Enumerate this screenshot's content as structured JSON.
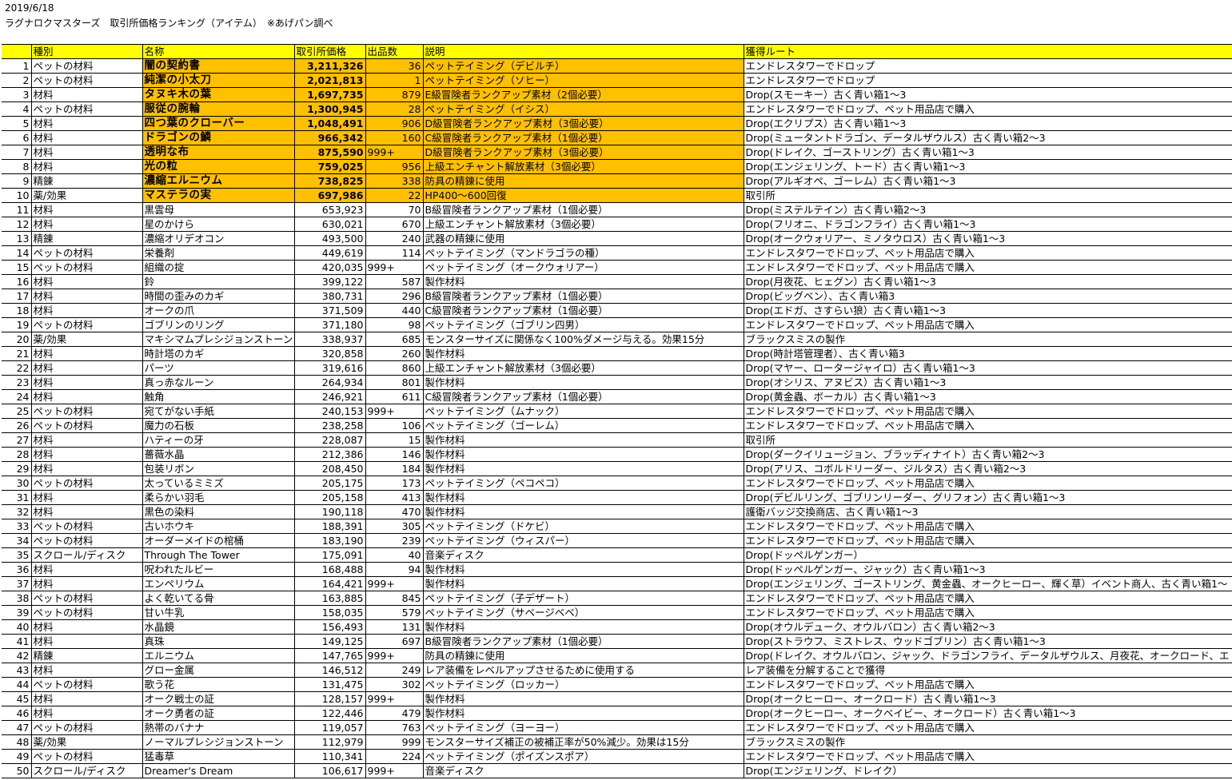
{
  "header": {
    "date": "2019/6/18",
    "title": "ラグナロクマスターズ　取引所価格ランキング（アイテム）　※あげパン調べ"
  },
  "columns": [
    "",
    "種別",
    "名称",
    "取引所価格",
    "出品数",
    "説明",
    "獲得ルート"
  ],
  "rows": [
    {
      "rank": "1",
      "type": "ペットの材料",
      "name": "闇の契約書",
      "price": "3,211,326",
      "count": "36",
      "desc": "ペットテイミング（デビルチ）",
      "route": "エンドレスタワーでドロップ"
    },
    {
      "rank": "2",
      "type": "ペットの材料",
      "name": "純潔の小太刀",
      "price": "2,021,813",
      "count": "1",
      "desc": "ペットテイミング（ソヒー）",
      "route": "エンドレスタワーでドロップ"
    },
    {
      "rank": "3",
      "type": "材料",
      "name": "タヌキ木の葉",
      "price": "1,697,735",
      "count": "879",
      "desc": "E級冒険者ランクアップ素材（2個必要）",
      "route": "Drop(スモーキー）古く青い箱1～3"
    },
    {
      "rank": "4",
      "type": "ペットの材料",
      "name": "服従の腕輪",
      "price": "1,300,945",
      "count": "28",
      "desc": "ペットテイミング（イシス）",
      "route": "エンドレスタワーでドロップ、ペット用品店で購入"
    },
    {
      "rank": "5",
      "type": "材料",
      "name": "四つ葉のクローバー",
      "price": "1,048,491",
      "count": "906",
      "desc": "D級冒険者ランクアップ素材（3個必要）",
      "route": "Drop(エクリプス）古く青い箱1～3"
    },
    {
      "rank": "6",
      "type": "材料",
      "name": "ドラゴンの鱗",
      "price": "966,342",
      "count": "160",
      "desc": "C級冒険者ランクアップ素材（1個必要）",
      "route": "Drop(ミュータントドラゴン、データルザウルス）古く青い箱2～3"
    },
    {
      "rank": "7",
      "type": "材料",
      "name": "透明な布",
      "price": "875,590",
      "count": "999+",
      "desc": "D級冒険者ランクアップ素材（3個必要）",
      "route": "Drop(ドレイク、ゴーストリング）古く青い箱1～3"
    },
    {
      "rank": "8",
      "type": "材料",
      "name": "光の粒",
      "price": "759,025",
      "count": "956",
      "desc": "上級エンチャント解放素材（3個必要）",
      "route": "Drop(エンジェリング、トード）古く青い箱1～3"
    },
    {
      "rank": "9",
      "type": "精錬",
      "name": "濃縮エルニウム",
      "price": "738,825",
      "count": "338",
      "desc": "防具の精錬に使用",
      "route": "Drop(アルギオペ、ゴーレム）古く青い箱1～3"
    },
    {
      "rank": "10",
      "type": "薬/効果",
      "name": "マステラの実",
      "price": "697,986",
      "count": "22",
      "desc": "HP400～600回復",
      "route": "取引所"
    },
    {
      "rank": "11",
      "type": "材料",
      "name": "黒雲母",
      "price": "653,923",
      "count": "70",
      "desc": "B級冒険者ランクアップ素材（1個必要）",
      "route": "Drop(ミステルテイン）古く青い箱2～3"
    },
    {
      "rank": "12",
      "type": "材料",
      "name": "星のかけら",
      "price": "630,021",
      "count": "670",
      "desc": "上級エンチャント解放素材（3個必要）",
      "route": "Drop(フリオニ、ドラゴンフライ）古く青い箱1～3"
    },
    {
      "rank": "13",
      "type": "精錬",
      "name": "濃縮オリデオコン",
      "price": "493,500",
      "count": "240",
      "desc": "武器の精錬に使用",
      "route": "Drop(オークウォリアー、ミノタウロス）古く青い箱1～3"
    },
    {
      "rank": "14",
      "type": "ペットの材料",
      "name": "栄養剤",
      "price": "449,619",
      "count": "114",
      "desc": "ペットテイミング（マンドラゴラの種）",
      "route": "エンドレスタワーでドロップ、ペット用品店で購入"
    },
    {
      "rank": "15",
      "type": "ペットの材料",
      "name": "組織の掟",
      "price": "420,035",
      "count": "999+",
      "desc": "ペットテイミング（オークウォリアー）",
      "route": "エンドレスタワーでドロップ、ペット用品店で購入"
    },
    {
      "rank": "16",
      "type": "材料",
      "name": "鈴",
      "price": "399,122",
      "count": "587",
      "desc": "製作材料",
      "route": "Drop(月夜花、ヒェグン）古く青い箱1～3"
    },
    {
      "rank": "17",
      "type": "材料",
      "name": "時間の歪みのカギ",
      "price": "380,731",
      "count": "296",
      "desc": "B級冒険者ランクアップ素材（1個必要）",
      "route": "Drop(ビッグベン）、古く青い箱3"
    },
    {
      "rank": "18",
      "type": "材料",
      "name": "オークの爪",
      "price": "371,509",
      "count": "440",
      "desc": "C級冒険者ランクアップ素材（1個必要）",
      "route": "Drop(エドガ、さすらい狼）古く青い箱1～3"
    },
    {
      "rank": "19",
      "type": "ペットの材料",
      "name": "ゴブリンのリング",
      "price": "371,180",
      "count": "98",
      "desc": "ペットテイミング（ゴブリン四男）",
      "route": "エンドレスタワーでドロップ、ペット用品店で購入"
    },
    {
      "rank": "20",
      "type": "薬/効果",
      "name": "マキシマムプレシジョンストーン",
      "price": "338,937",
      "count": "685",
      "desc": "モンスターサイズに関係なく100%ダメージ与える。効果15分",
      "route": "ブラックスミスの製作"
    },
    {
      "rank": "21",
      "type": "材料",
      "name": "時計塔のカギ",
      "price": "320,858",
      "count": "260",
      "desc": "製作材料",
      "route": "Drop(時計塔管理者）、古く青い箱3"
    },
    {
      "rank": "22",
      "type": "材料",
      "name": "パーツ",
      "price": "319,616",
      "count": "860",
      "desc": "上級エンチャント解放素材（3個必要）",
      "route": "Drop(マヤー、ロータージャイロ）古く青い箱1～3"
    },
    {
      "rank": "23",
      "type": "材料",
      "name": "真っ赤なルーン",
      "price": "264,934",
      "count": "801",
      "desc": "製作材料",
      "route": "Drop(オシリス、アヌビス）古く青い箱1～3"
    },
    {
      "rank": "24",
      "type": "材料",
      "name": "触角",
      "price": "246,921",
      "count": "611",
      "desc": "C級冒険者ランクアップ素材（1個必要）",
      "route": "Drop(黄金蟲、ボーカル）古く青い箱1～3"
    },
    {
      "rank": "25",
      "type": "ペットの材料",
      "name": "宛てがない手紙",
      "price": "240,153",
      "count": "999+",
      "desc": "ペットテイミング（ムナック）",
      "route": "エンドレスタワーでドロップ、ペット用品店で購入"
    },
    {
      "rank": "26",
      "type": "ペットの材料",
      "name": "魔力の石板",
      "price": "238,258",
      "count": "106",
      "desc": "ペットテイミング（ゴーレム）",
      "route": "エンドレスタワーでドロップ、ペット用品店で購入"
    },
    {
      "rank": "27",
      "type": "材料",
      "name": "ハティーの牙",
      "price": "228,087",
      "count": "15",
      "desc": "製作材料",
      "route": "取引所"
    },
    {
      "rank": "28",
      "type": "材料",
      "name": "薔薇水晶",
      "price": "212,386",
      "count": "146",
      "desc": "製作材料",
      "route": "Drop(ダークイリュージョン、ブラッディナイト）古く青い箱2～3"
    },
    {
      "rank": "29",
      "type": "材料",
      "name": "包装リボン",
      "price": "208,450",
      "count": "184",
      "desc": "製作材料",
      "route": "Drop(アリス、コボルドリーダー、ジルタス）古く青い箱2～3"
    },
    {
      "rank": "30",
      "type": "ペットの材料",
      "name": "太っているミミズ",
      "price": "205,175",
      "count": "173",
      "desc": "ペットテイミング（ペコペコ）",
      "route": "エンドレスタワーでドロップ、ペット用品店で購入"
    },
    {
      "rank": "31",
      "type": "材料",
      "name": "柔らかい羽毛",
      "price": "205,158",
      "count": "413",
      "desc": "製作材料",
      "route": "Drop(デビルリング、ゴブリンリーダー、グリフォン）古く青い箱1～3"
    },
    {
      "rank": "32",
      "type": "材料",
      "name": "黒色の染料",
      "price": "190,118",
      "count": "470",
      "desc": "製作材料",
      "route": "護衛バッジ交換商店、古く青い箱1～3"
    },
    {
      "rank": "33",
      "type": "ペットの材料",
      "name": "古いホウキ",
      "price": "188,391",
      "count": "305",
      "desc": "ペットテイミング（ドケビ）",
      "route": "エンドレスタワーでドロップ、ペット用品店で購入"
    },
    {
      "rank": "34",
      "type": "ペットの材料",
      "name": "オーダーメイドの棺桶",
      "price": "183,190",
      "count": "239",
      "desc": "ペットテイミング（ウィスパー）",
      "route": "エンドレスタワーでドロップ、ペット用品店で購入"
    },
    {
      "rank": "35",
      "type": "スクロール/ディスク",
      "name": "Through The Tower",
      "price": "175,091",
      "count": "40",
      "desc": "音楽ディスク",
      "route": "Drop(ドッペルゲンガー）"
    },
    {
      "rank": "36",
      "type": "材料",
      "name": "呪われたルビー",
      "price": "168,488",
      "count": "94",
      "desc": "製作材料",
      "route": "Drop(ドッペルゲンガー、ジャック）古く青い箱1～3"
    },
    {
      "rank": "37",
      "type": "材料",
      "name": "エンペリウム",
      "price": "164,421",
      "count": "999+",
      "desc": "製作材料",
      "route": "Drop(エンジェリング、ゴーストリング、黄金蟲、オークヒーロー、輝く草）イベント商人、古く青い箱1～"
    },
    {
      "rank": "38",
      "type": "ペットの材料",
      "name": "よく乾いてる骨",
      "price": "163,885",
      "count": "845",
      "desc": "ペットテイミング（子デザート）",
      "route": "エンドレスタワーでドロップ、ペット用品店で購入"
    },
    {
      "rank": "39",
      "type": "ペットの材料",
      "name": "甘い牛乳",
      "price": "158,035",
      "count": "579",
      "desc": "ペットテイミング（サベージベベ）",
      "route": "エンドレスタワーでドロップ、ペット用品店で購入"
    },
    {
      "rank": "40",
      "type": "材料",
      "name": "水晶鏡",
      "price": "156,493",
      "count": "131",
      "desc": "製作材料",
      "route": "Drop(オウルデューク、オウルバロン）古く青い箱2～3"
    },
    {
      "rank": "41",
      "type": "材料",
      "name": "真珠",
      "price": "149,125",
      "count": "697",
      "desc": "B級冒険者ランクアップ素材（1個必要）",
      "route": "Drop(ストラウフ、ミストレス、ウッドゴブリン）古く青い箱1～3"
    },
    {
      "rank": "42",
      "type": "精錬",
      "name": "エルニウム",
      "price": "147,765",
      "count": "999+",
      "desc": "防具の精錬に使用",
      "route": "Drop(ドレイク、オウルバロン、ジャック、ドラゴンフライ、データルザウルス、月夜花、オークロード、エ"
    },
    {
      "rank": "43",
      "type": "材料",
      "name": "グロー金属",
      "price": "146,512",
      "count": "249",
      "desc": "レア装備をレベルアップさせるために使用する",
      "route": "レア装備を分解することで獲得"
    },
    {
      "rank": "44",
      "type": "ペットの材料",
      "name": "歌う花",
      "price": "131,475",
      "count": "302",
      "desc": "ペットテイミング（ロッカー）",
      "route": "エンドレスタワーでドロップ、ペット用品店で購入"
    },
    {
      "rank": "45",
      "type": "材料",
      "name": "オーク戦士の証",
      "price": "128,157",
      "count": "999+",
      "desc": "製作材料",
      "route": "Drop(オークヒーロー、オークロード）古く青い箱1～3"
    },
    {
      "rank": "46",
      "type": "材料",
      "name": "オーク勇者の証",
      "price": "122,446",
      "count": "479",
      "desc": "製作材料",
      "route": "Drop(オークヒーロー、オークベイビー、オークロード）古く青い箱1～3"
    },
    {
      "rank": "47",
      "type": "ペットの材料",
      "name": "熱帯のバナナ",
      "price": "119,057",
      "count": "763",
      "desc": "ペットテイミング（ヨーヨー）",
      "route": "エンドレスタワーでドロップ、ペット用品店で購入"
    },
    {
      "rank": "48",
      "type": "薬/効果",
      "name": "ノーマルプレシジョンストーン",
      "price": "112,979",
      "count": "999",
      "desc": "モンスターサイズ補正の被補正率が50%減少。効果は15分",
      "route": "ブラックスミスの製作"
    },
    {
      "rank": "49",
      "type": "ペットの材料",
      "name": "猛毒草",
      "price": "110,341",
      "count": "224",
      "desc": "ペットテイミング（ポイズンスポア）",
      "route": "エンドレスタワーでドロップ、ペット用品店で購入"
    },
    {
      "rank": "50",
      "type": "スクロール/ディスク",
      "name": "Dreamer's Dream",
      "price": "106,617",
      "count": "999+",
      "desc": "音楽ディスク",
      "route": "Drop(エンジェリング、ドレイク）"
    }
  ]
}
